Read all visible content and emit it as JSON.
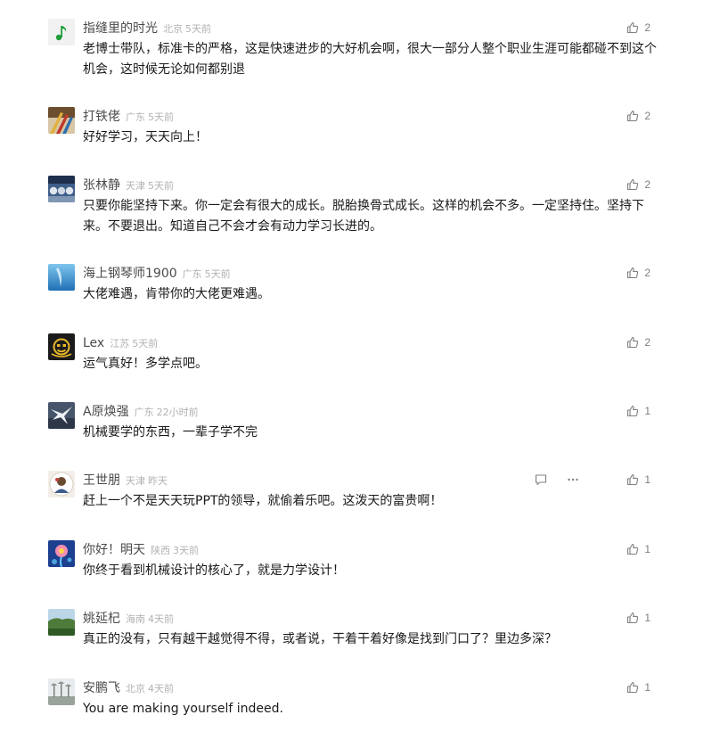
{
  "comments": [
    {
      "name": "指缝里的时光",
      "location": "北京",
      "time": "5天前",
      "text": "老博士带队，标准卡的严格，这是快速进步的大好机会啊，很大一部分人整个职业生涯可能都碰不到这个机会，这时候无论如何都别退",
      "likes": "2",
      "avatar": "music-note-avatar"
    },
    {
      "name": "打铁佬",
      "location": "广东",
      "time": "5天前",
      "text": "好好学习，天天向上！",
      "likes": "2",
      "avatar": "pencils-avatar"
    },
    {
      "name": "张林静",
      "location": "天津",
      "time": "5天前",
      "text": "只要你能坚持下来。你一定会有很大的成长。脱胎换骨式成长。这样的机会不多。一定坚持住。坚持下来。不要退出。知道自己不会才会有动力学习长进的。",
      "likes": "2",
      "avatar": "group-avatar"
    },
    {
      "name": "海上钢琴师1900",
      "location": "广东",
      "time": "5天前",
      "text": "大佬难遇，肯带你的大佬更难遇。",
      "likes": "2",
      "avatar": "underwater-avatar"
    },
    {
      "name": "Lex",
      "location": "江苏",
      "time": "5天前",
      "text": "运气真好！多学点吧。",
      "likes": "2",
      "avatar": "face-icon-avatar"
    },
    {
      "name": "A原焕强",
      "location": "广东",
      "time": "22小时前",
      "text": "机械要学的东西，一辈子学不完",
      "likes": "1",
      "avatar": "bird-avatar"
    },
    {
      "name": "王世朋",
      "location": "天津",
      "time": "昨天",
      "text": "赶上一个不是天天玩PPT的领导，就偷着乐吧。这泼天的富贵啊！",
      "likes": "1",
      "avatar": "cartoon-avatar",
      "show_actions": true
    },
    {
      "name": "你好！明天",
      "location": "陕西",
      "time": "3天前",
      "text": "你终于看到机械设计的核心了，就是力学设计！",
      "likes": "1",
      "avatar": "flower-avatar"
    },
    {
      "name": "姚延杞",
      "location": "海南",
      "time": "4天前",
      "text": "真正的没有，只有越干越觉得不得，或者说，干着干着好像是找到门口了？里边多深？",
      "likes": "1",
      "avatar": "landscape-avatar"
    },
    {
      "name": "安鹏飞",
      "location": "北京",
      "time": "4天前",
      "text": "You are making yourself indeed.",
      "likes": "1",
      "avatar": "tree-avatar"
    }
  ]
}
